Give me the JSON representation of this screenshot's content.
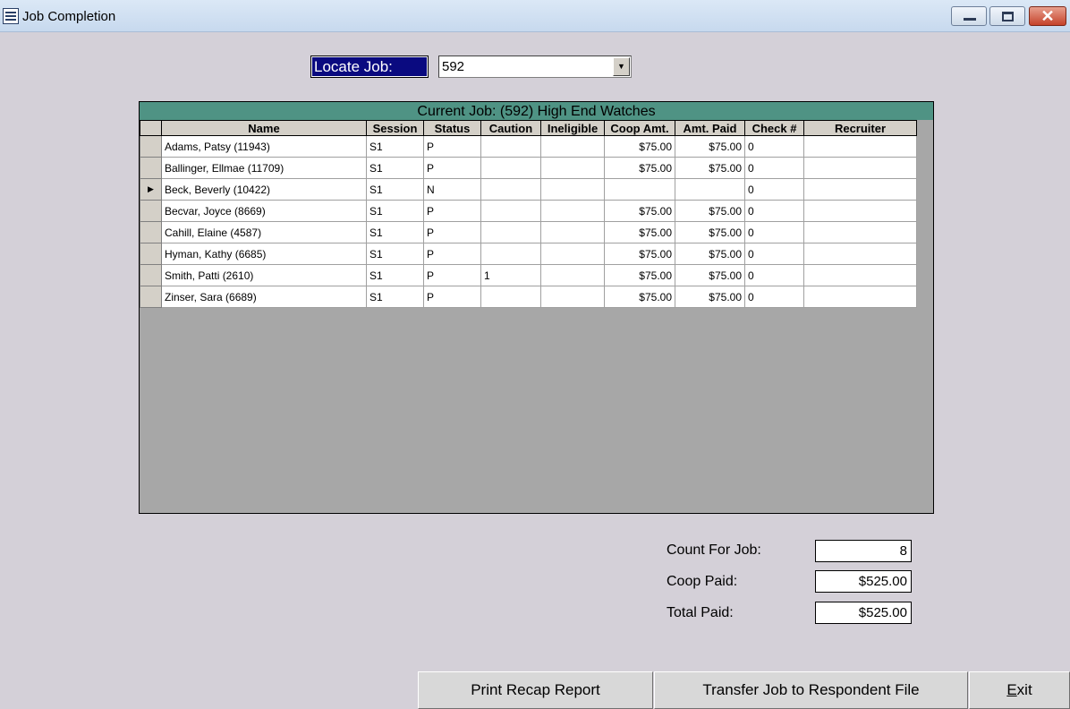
{
  "window": {
    "title": "Job Completion",
    "close_glyph": "✕",
    "icon": "datasheet-icon"
  },
  "locate": {
    "label": "Locate Job:",
    "value": "592",
    "drop_glyph": "▼"
  },
  "grid": {
    "caption": "Current Job: (592) High End Watches",
    "columns": [
      "Name",
      "Session",
      "Status",
      "Caution",
      "Ineligible",
      "Coop Amt.",
      "Amt. Paid",
      "Check #",
      "Recruiter"
    ],
    "current_row_marker": "▶",
    "rows": [
      {
        "name": "Adams, Patsy (11943)",
        "session": "S1",
        "status": "P",
        "caution": "",
        "ineligible": "",
        "coop": "$75.00",
        "paid": "$75.00",
        "check": "0",
        "recruiter": "",
        "current": false
      },
      {
        "name": "Ballinger, Ellmae (11709)",
        "session": "S1",
        "status": "P",
        "caution": "",
        "ineligible": "",
        "coop": "$75.00",
        "paid": "$75.00",
        "check": "0",
        "recruiter": "",
        "current": false
      },
      {
        "name": "Beck, Beverly (10422)",
        "session": "S1",
        "status": "N",
        "caution": "",
        "ineligible": "",
        "coop": "",
        "paid": "",
        "check": "0",
        "recruiter": "",
        "current": true
      },
      {
        "name": "Becvar, Joyce (8669)",
        "session": "S1",
        "status": "P",
        "caution": "",
        "ineligible": "",
        "coop": "$75.00",
        "paid": "$75.00",
        "check": "0",
        "recruiter": "",
        "current": false
      },
      {
        "name": "Cahill, Elaine (4587)",
        "session": "S1",
        "status": "P",
        "caution": "",
        "ineligible": "",
        "coop": "$75.00",
        "paid": "$75.00",
        "check": "0",
        "recruiter": "",
        "current": false
      },
      {
        "name": "Hyman, Kathy (6685)",
        "session": "S1",
        "status": "P",
        "caution": "",
        "ineligible": "",
        "coop": "$75.00",
        "paid": "$75.00",
        "check": "0",
        "recruiter": "",
        "current": false
      },
      {
        "name": "Smith, Patti (2610)",
        "session": "S1",
        "status": "P",
        "caution": "1",
        "ineligible": "",
        "coop": "$75.00",
        "paid": "$75.00",
        "check": "0",
        "recruiter": "",
        "current": false
      },
      {
        "name": "Zinser, Sara (6689)",
        "session": "S1",
        "status": "P",
        "caution": "",
        "ineligible": "",
        "coop": "$75.00",
        "paid": "$75.00",
        "check": "0",
        "recruiter": "",
        "current": false
      }
    ]
  },
  "totals": {
    "count_label": "Count For Job:",
    "count_value": "8",
    "coop_label": "Coop Paid:",
    "coop_value": "$525.00",
    "total_label": "Total Paid:",
    "total_value": "$525.00"
  },
  "buttons": {
    "print": "Print Recap Report",
    "transfer": "Transfer Job to Respondent File",
    "exit_hotkey": "E",
    "exit_rest": "xit"
  }
}
